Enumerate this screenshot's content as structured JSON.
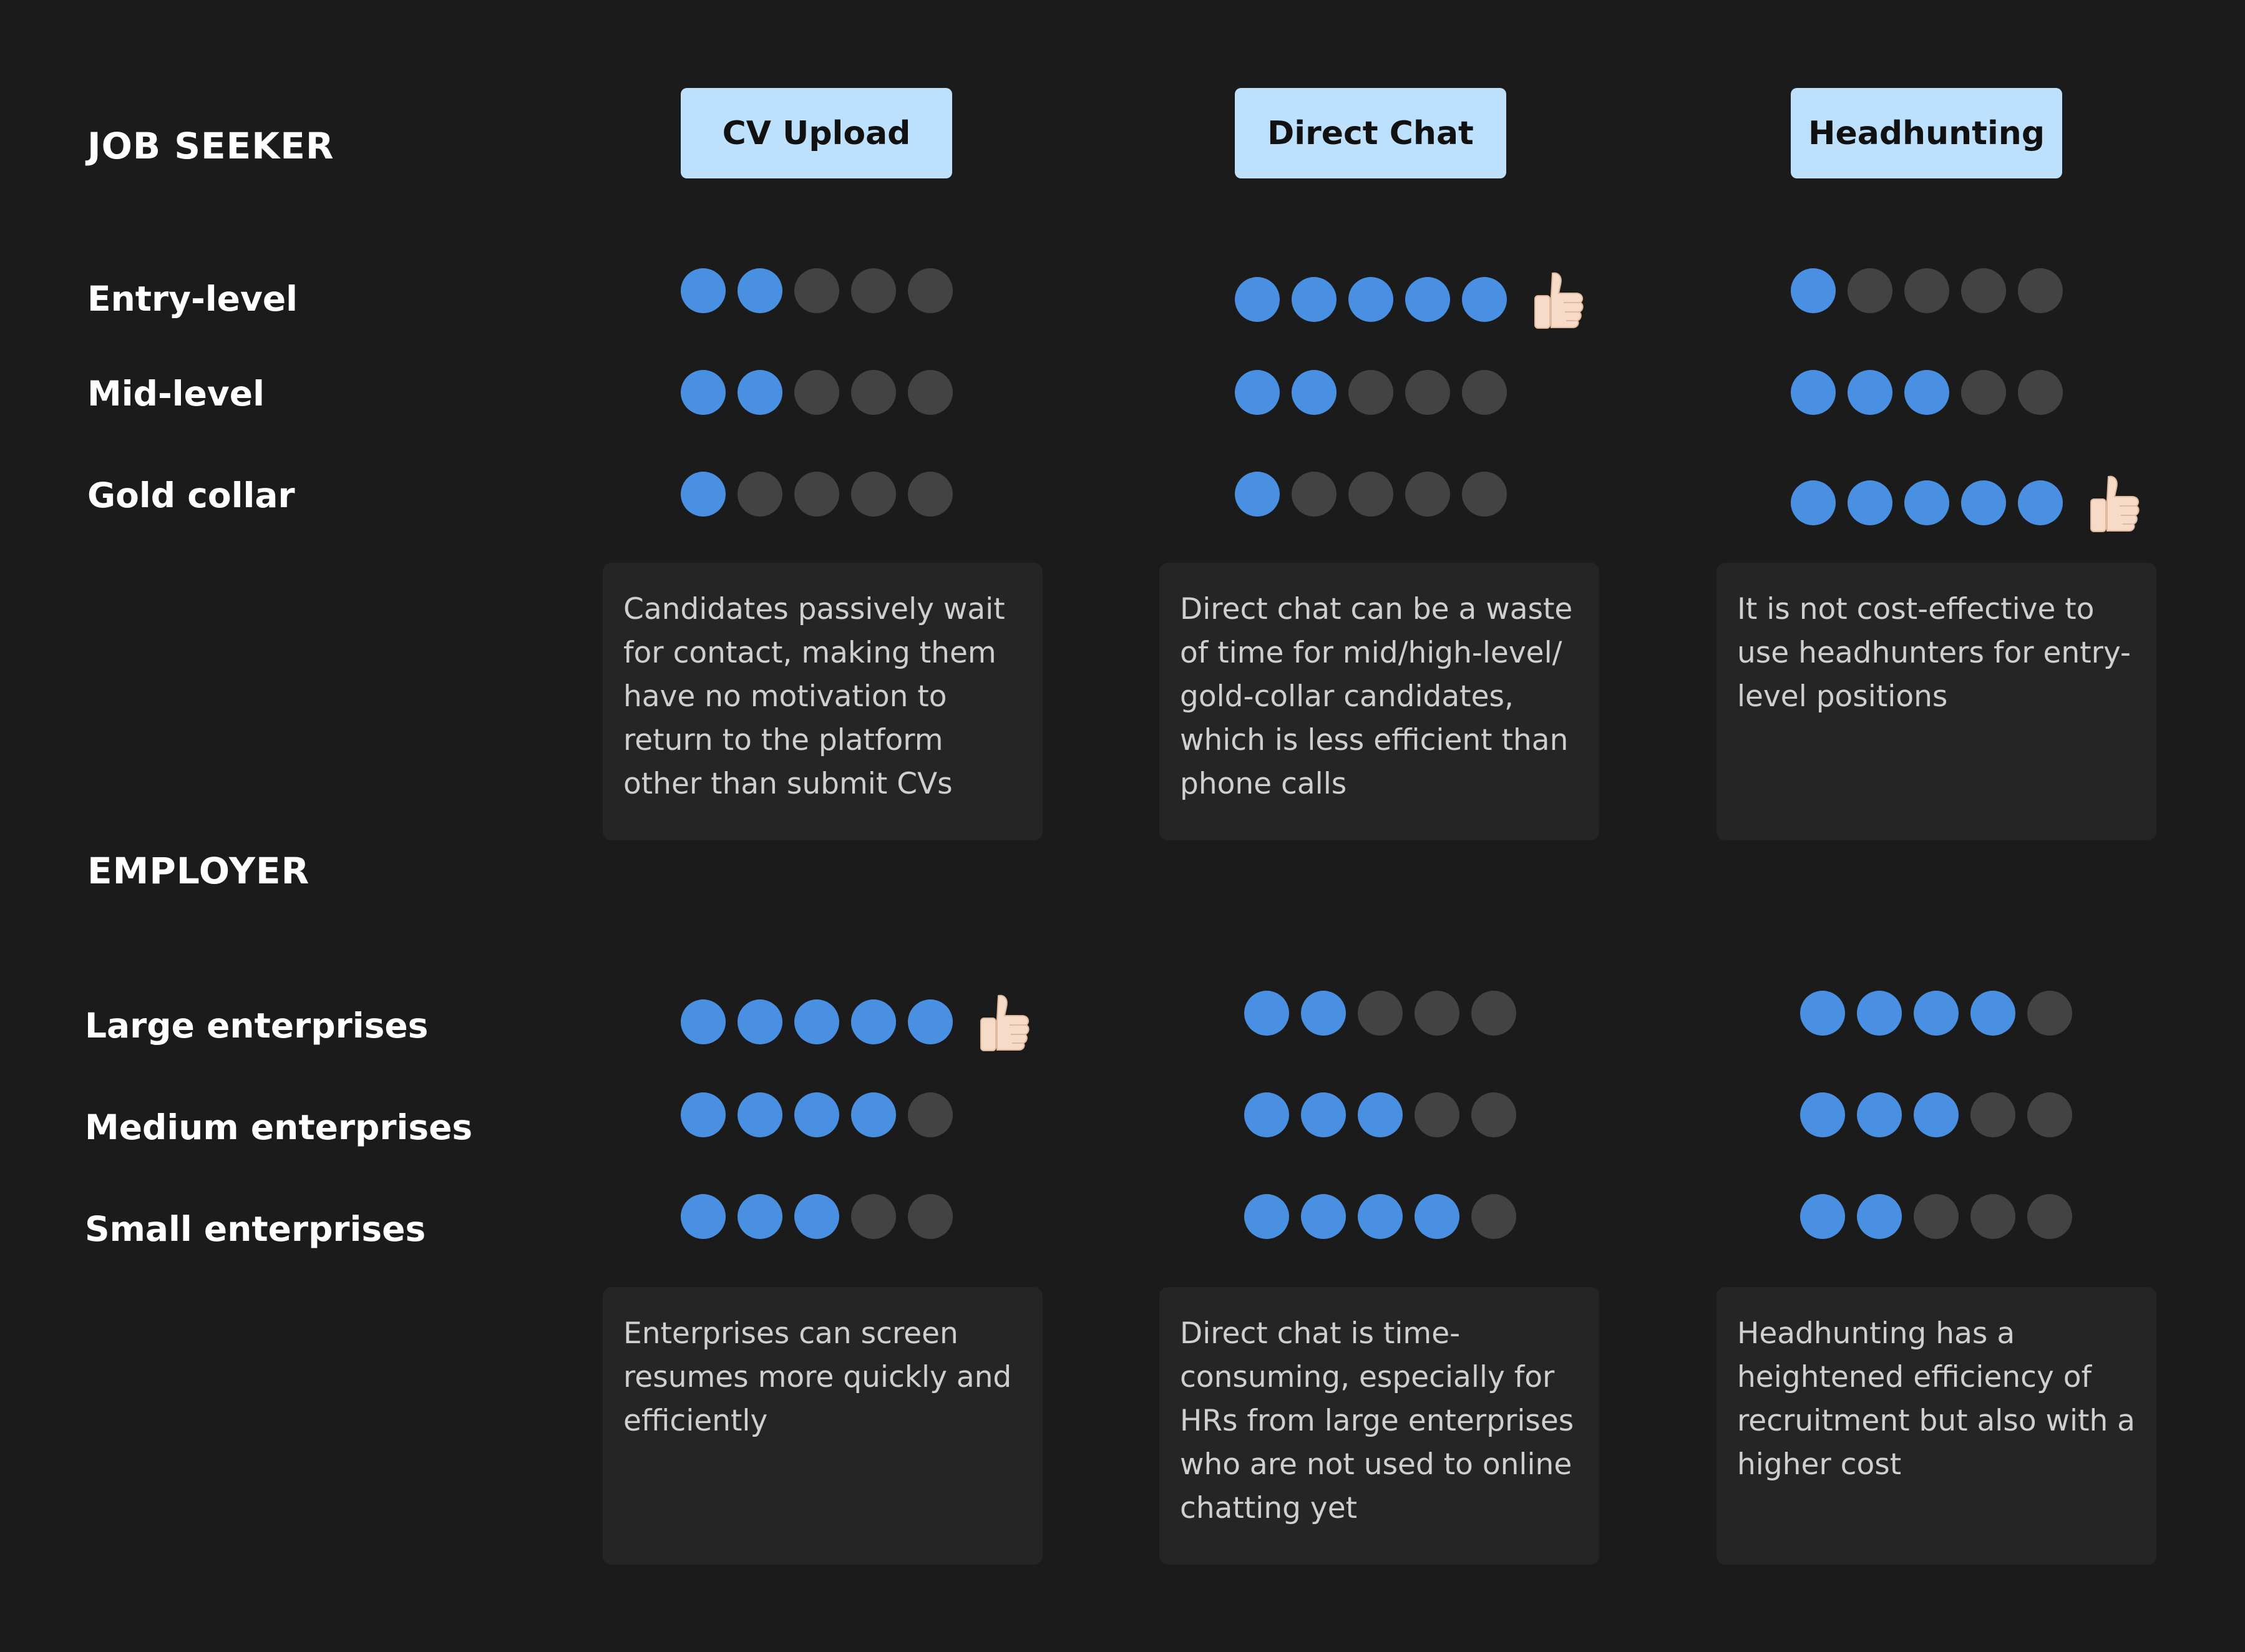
{
  "methods": [
    "CV Upload",
    "Direct Chat",
    "Headhunting"
  ],
  "job_seeker": {
    "title": "JOB SEEKER",
    "rows": [
      {
        "label": "Entry-level",
        "ratings": [
          2,
          5,
          1
        ],
        "recommended": [
          false,
          true,
          false
        ]
      },
      {
        "label": "Mid-level",
        "ratings": [
          2,
          2,
          3
        ],
        "recommended": [
          false,
          false,
          false
        ]
      },
      {
        "label": "Gold collar",
        "ratings": [
          1,
          1,
          5
        ],
        "recommended": [
          false,
          false,
          true
        ]
      }
    ],
    "notes": [
      "Candidates passively wait for contact, making them have no motivation to return to the platform other than submit CVs",
      "Direct chat can be a waste of time for mid/high-level/ gold-collar candidates, which is less efficient than phone calls",
      "It is not cost-effective to use headhunters for entry-level positions"
    ]
  },
  "employer": {
    "title": "EMPLOYER",
    "rows": [
      {
        "label": "Large enterprises",
        "ratings": [
          5,
          2,
          4
        ],
        "recommended": [
          true,
          false,
          false
        ]
      },
      {
        "label": "Medium enterprises",
        "ratings": [
          4,
          3,
          3
        ],
        "recommended": [
          false,
          false,
          false
        ]
      },
      {
        "label": "Small enterprises",
        "ratings": [
          3,
          4,
          2
        ],
        "recommended": [
          false,
          false,
          false
        ]
      }
    ],
    "notes": [
      "Enterprises can screen resumes more quickly and efficiently",
      "Direct chat is time-consuming, especially for HRs from large enterprises who are not used to online chatting yet",
      "Headhunting has a heightened efficiency of recruitment but also with a higher cost"
    ]
  },
  "rating_scale_max": 5,
  "icons": {
    "recommended": "thumbs-up-icon"
  },
  "colors": {
    "filled": "#4a90e2",
    "empty": "#434343",
    "tag_bg": "#bde0fc",
    "background": "#1b1b1b",
    "note_bg": "#252525"
  }
}
